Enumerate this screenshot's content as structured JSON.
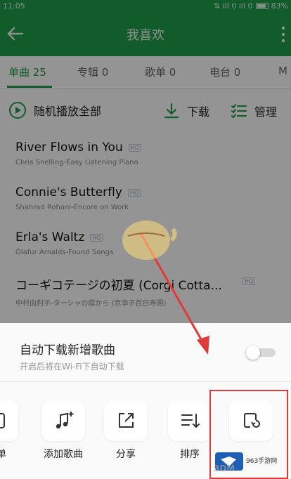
{
  "status": {
    "time": "11:05",
    "battery": "83%",
    "signal": "⇅ ill 0 ill 0"
  },
  "toolbar": {
    "title": "我喜欢"
  },
  "tabs": [
    {
      "label": "单曲 25"
    },
    {
      "label": "专辑 0"
    },
    {
      "label": "歌单 0"
    },
    {
      "label": "电台 0"
    },
    {
      "label": "M"
    }
  ],
  "actions": {
    "play_all": "随机播放全部",
    "download": "下载",
    "manage": "管理"
  },
  "songs": [
    {
      "title": "River Flows in You",
      "badge": "HQ",
      "artist": "Chris Snelling-Easy Listening Piano"
    },
    {
      "title": "Connie's Butterfly",
      "badge": "HQ",
      "artist": "Shahrad Rohani-Encore on Work"
    },
    {
      "title": "Erla's Waltz",
      "badge": "HQ",
      "artist": "Ólafur Arnalds-Found Songs"
    },
    {
      "title": "コーギコテージの初夏 (Corgi Cotta...",
      "badge": "HQ",
      "artist": "中村由利子-ターシャの庭から (京华子百日寿阁)"
    }
  ],
  "sheet": {
    "auto_title": "自动下载新增歌曲",
    "auto_sub": "开启后将在Wi-Fi下自动下载",
    "buttons": [
      {
        "label": "歌单",
        "icon": "add-to-playlist-icon"
      },
      {
        "label": "添加歌曲",
        "icon": "add-music-icon"
      },
      {
        "label": "分享",
        "icon": "share-icon"
      },
      {
        "label": "排序",
        "icon": "sort-icon"
      },
      {
        "label": "",
        "icon": "restore-icon"
      }
    ]
  },
  "watermark": {
    "brand": "3DM",
    "site": "963手游网"
  },
  "colors": {
    "accent": "#1f9e4b",
    "highlight": "#e23a3a"
  }
}
